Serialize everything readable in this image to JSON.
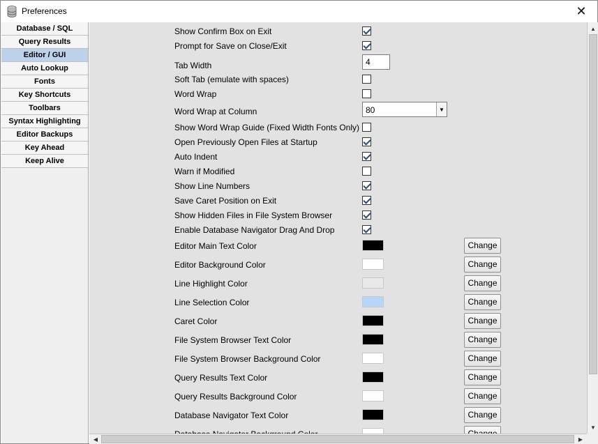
{
  "window": {
    "title": "Preferences",
    "close_label": "✕"
  },
  "sidebar": {
    "active_index": 2,
    "items": [
      {
        "label": "Database / SQL"
      },
      {
        "label": "Query Results"
      },
      {
        "label": "Editor / GUI"
      },
      {
        "label": "Auto Lookup"
      },
      {
        "label": "Fonts"
      },
      {
        "label": "Key Shortcuts"
      },
      {
        "label": "Toolbars"
      },
      {
        "label": "Syntax Highlighting"
      },
      {
        "label": "Editor Backups"
      },
      {
        "label": "Key Ahead"
      },
      {
        "label": "Keep Alive"
      }
    ]
  },
  "settings": [
    {
      "label": "Show Confirm Box on Exit",
      "type": "checkbox",
      "checked": true
    },
    {
      "label": "Prompt for Save on Close/Exit",
      "type": "checkbox",
      "checked": true
    },
    {
      "label": "Tab Width",
      "type": "text",
      "value": "4"
    },
    {
      "label": "Soft Tab (emulate with spaces)",
      "type": "checkbox",
      "checked": false
    },
    {
      "label": "Word Wrap",
      "type": "checkbox",
      "checked": false
    },
    {
      "label": "Word Wrap at Column",
      "type": "combo",
      "value": "80"
    },
    {
      "label": "Show Word Wrap Guide (Fixed Width Fonts Only)",
      "type": "checkbox",
      "checked": false
    },
    {
      "label": "Open Previously Open Files at Startup",
      "type": "checkbox",
      "checked": true
    },
    {
      "label": "Auto Indent",
      "type": "checkbox",
      "checked": true
    },
    {
      "label": "Warn if Modified",
      "type": "checkbox",
      "checked": false
    },
    {
      "label": "Show Line Numbers",
      "type": "checkbox",
      "checked": true
    },
    {
      "label": "Save Caret Position on Exit",
      "type": "checkbox",
      "checked": true
    },
    {
      "label": "Show Hidden Files in File System Browser",
      "type": "checkbox",
      "checked": true
    },
    {
      "label": "Enable Database Navigator Drag And Drop",
      "type": "checkbox",
      "checked": true
    }
  ],
  "colors": [
    {
      "label": "Editor Main Text Color",
      "color": "#000000"
    },
    {
      "label": "Editor Background Color",
      "color": "#ffffff"
    },
    {
      "label": "Line Highlight Color",
      "color": "#e8e8e8"
    },
    {
      "label": "Line Selection Color",
      "color": "#b8d4f6"
    },
    {
      "label": "Caret Color",
      "color": "#000000"
    },
    {
      "label": "File System Browser Text Color",
      "color": "#000000"
    },
    {
      "label": "File System Browser Background Color",
      "color": "#ffffff"
    },
    {
      "label": "Query Results Text Color",
      "color": "#000000"
    },
    {
      "label": "Query Results Background Color",
      "color": "#ffffff"
    },
    {
      "label": "Database Navigator Text Color",
      "color": "#000000"
    },
    {
      "label": "Database Navigator Background Color",
      "color": "#ffffff"
    }
  ],
  "change_label": "Change",
  "icons": {
    "app": "database-icon",
    "close": "close-icon",
    "combo": "chevron-down-icon",
    "scroll_up": "arrow-up-icon",
    "scroll_down": "arrow-down-icon",
    "scroll_left": "arrow-left-icon",
    "scroll_right": "arrow-right-icon"
  }
}
